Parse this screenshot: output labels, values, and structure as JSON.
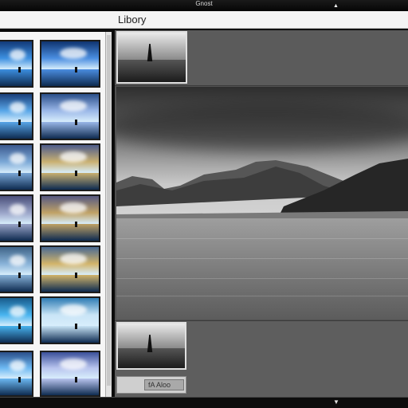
{
  "window": {
    "title": "Gnost",
    "up_icon": "▲"
  },
  "menubar": {
    "label": "Libory"
  },
  "main_viewer": {
    "caption_text": "fA Aloo"
  },
  "statusbar": {
    "down_icon": "▼"
  },
  "colors": {
    "sidebar_bg": "#f6f6f6",
    "viewer_bg": "#515151",
    "titlebar_bg": "#0a0a0a"
  },
  "icons": [
    "chevron-up-icon",
    "chevron-down-icon"
  ]
}
